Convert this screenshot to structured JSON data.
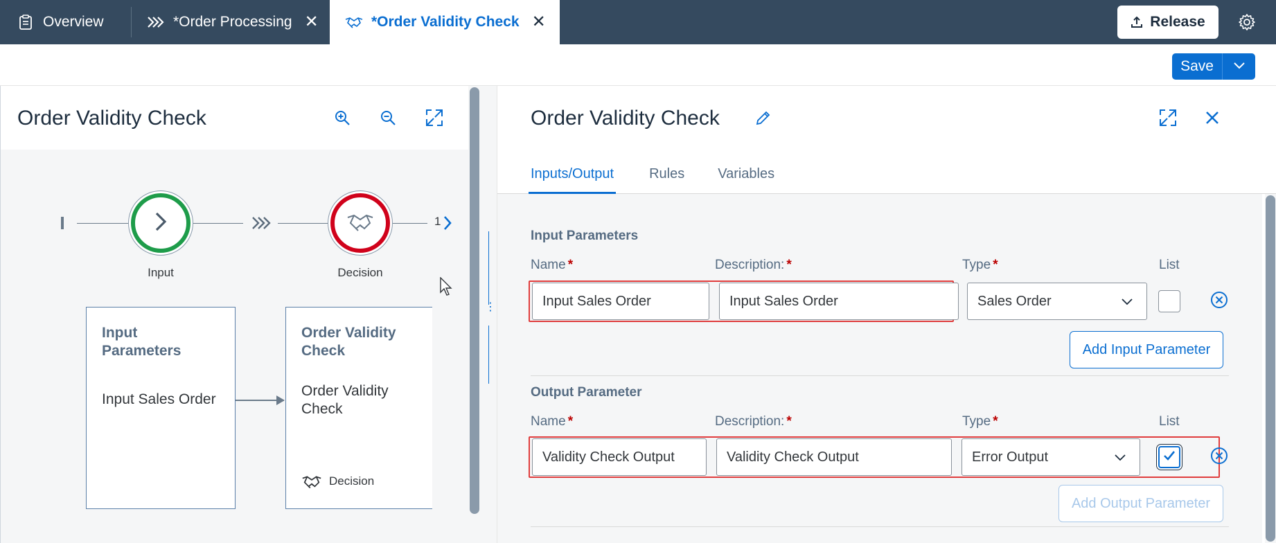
{
  "tabs": [
    {
      "label": "Overview",
      "icon": "clipboard-icon",
      "active": false
    },
    {
      "label": "*Order Processing",
      "icon": "process-flow-icon",
      "active": false,
      "closable": true
    },
    {
      "label": "*Order Validity Check",
      "icon": "handshake-icon",
      "active": true,
      "closable": true
    }
  ],
  "header": {
    "release_label": "Release"
  },
  "toolbar": {
    "save_label": "Save"
  },
  "left_panel": {
    "title": "Order Validity Check",
    "flow": {
      "nodes": [
        {
          "label": "Input",
          "color": "#1e9c4a"
        },
        {
          "label": "Decision",
          "color": "#d0021b"
        }
      ],
      "next_count": "1"
    },
    "cards": [
      {
        "title": "Input Parameters",
        "body": "Input Sales Order"
      },
      {
        "title": "Order Validity Check",
        "body": "Order Validity Check",
        "footer": "Decision"
      }
    ]
  },
  "right_panel": {
    "title": "Order Validity Check",
    "tabs": [
      "Inputs/Output",
      "Rules",
      "Variables"
    ],
    "input_section": {
      "title": "Input Parameters",
      "columns": {
        "name": "Name",
        "description": "Description:",
        "type": "Type",
        "list": "List"
      },
      "row": {
        "name": "Input Sales Order",
        "description": "Input Sales Order",
        "type": "Sales Order",
        "list_checked": false
      },
      "add_label": "Add Input Parameter"
    },
    "output_section": {
      "title": "Output Parameter",
      "columns": {
        "name": "Name",
        "description": "Description:",
        "type": "Type",
        "list": "List"
      },
      "row": {
        "name": "Validity Check Output",
        "description": "Validity Check Output",
        "type": "Error Output",
        "list_checked": true
      },
      "add_label": "Add Output Parameter"
    }
  },
  "colors": {
    "shell": "#354a5f",
    "accent": "#0a6ed1",
    "highlight": "#e03c3c"
  }
}
